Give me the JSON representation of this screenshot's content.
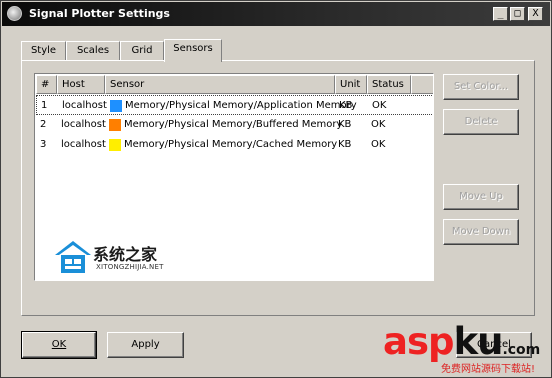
{
  "window": {
    "title": "Signal Plotter Settings",
    "controls": {
      "minimize": "_",
      "maximize": "□",
      "close": "X"
    }
  },
  "tabs": [
    {
      "label": "Style",
      "active": false
    },
    {
      "label": "Scales",
      "active": false
    },
    {
      "label": "Grid",
      "active": false
    },
    {
      "label": "Sensors",
      "active": true
    }
  ],
  "sensors_table": {
    "columns": [
      "#",
      "Host",
      "Sensor",
      "Unit",
      "Status"
    ],
    "rows": [
      {
        "num": "1",
        "host": "localhost",
        "sensor": "Memory/Physical Memory/Application Memory",
        "unit": "KB",
        "status": "OK",
        "color": "#1e90ff"
      },
      {
        "num": "2",
        "host": "localhost",
        "sensor": "Memory/Physical Memory/Buffered Memory",
        "unit": "KB",
        "status": "OK",
        "color": "#ff7f00"
      },
      {
        "num": "3",
        "host": "localhost",
        "sensor": "Memory/Physical Memory/Cached Memory",
        "unit": "KB",
        "status": "OK",
        "color": "#ffee00"
      }
    ]
  },
  "side_buttons": {
    "set_color": "Set Color...",
    "delete": "Delete",
    "move_up": "Move Up",
    "move_down": "Move Down"
  },
  "bottom_buttons": {
    "ok": "OK",
    "apply": "Apply",
    "cancel": "Cancel"
  },
  "watermarks": {
    "site_cn": "系统之家",
    "site_en": "XITONGZHIJIA.NET",
    "aspku": {
      "asp": "asp",
      "ku": "ku",
      "com": ".com",
      "sub": "免费网站源码下载站!"
    }
  },
  "colors": {
    "window_bg": "#d4d0c8",
    "titlebar": "#0a0a0a",
    "aspku_asp": "#ee2222",
    "aspku_ku": "#111111"
  }
}
